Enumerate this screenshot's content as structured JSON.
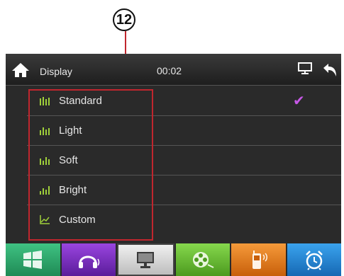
{
  "callout": {
    "number": "12"
  },
  "titlebar": {
    "title": "Display",
    "time": "00:02"
  },
  "list": {
    "items": [
      {
        "label": "Standard",
        "icon": "level-bars-icon",
        "selected": true
      },
      {
        "label": "Light",
        "icon": "level-bars-icon",
        "selected": false
      },
      {
        "label": "Soft",
        "icon": "level-bars-icon",
        "selected": false
      },
      {
        "label": "Bright",
        "icon": "level-bars-icon",
        "selected": false
      },
      {
        "label": "Custom",
        "icon": "custom-curve-icon",
        "selected": false
      }
    ]
  },
  "dock": {
    "items": [
      {
        "icon": "windows-icon",
        "color": "#2aa86a"
      },
      {
        "icon": "headphones-icon",
        "color": "#7a2fc0"
      },
      {
        "icon": "monitor-icon",
        "color": "#d8d8d8"
      },
      {
        "icon": "film-reel-icon",
        "color": "#6cc23a"
      },
      {
        "icon": "phone-icon",
        "color": "#ee7d1a"
      },
      {
        "icon": "alarm-clock-icon",
        "color": "#2389d6"
      }
    ]
  },
  "colors": {
    "check": "#c658e6",
    "highlight": "#c0262e"
  }
}
